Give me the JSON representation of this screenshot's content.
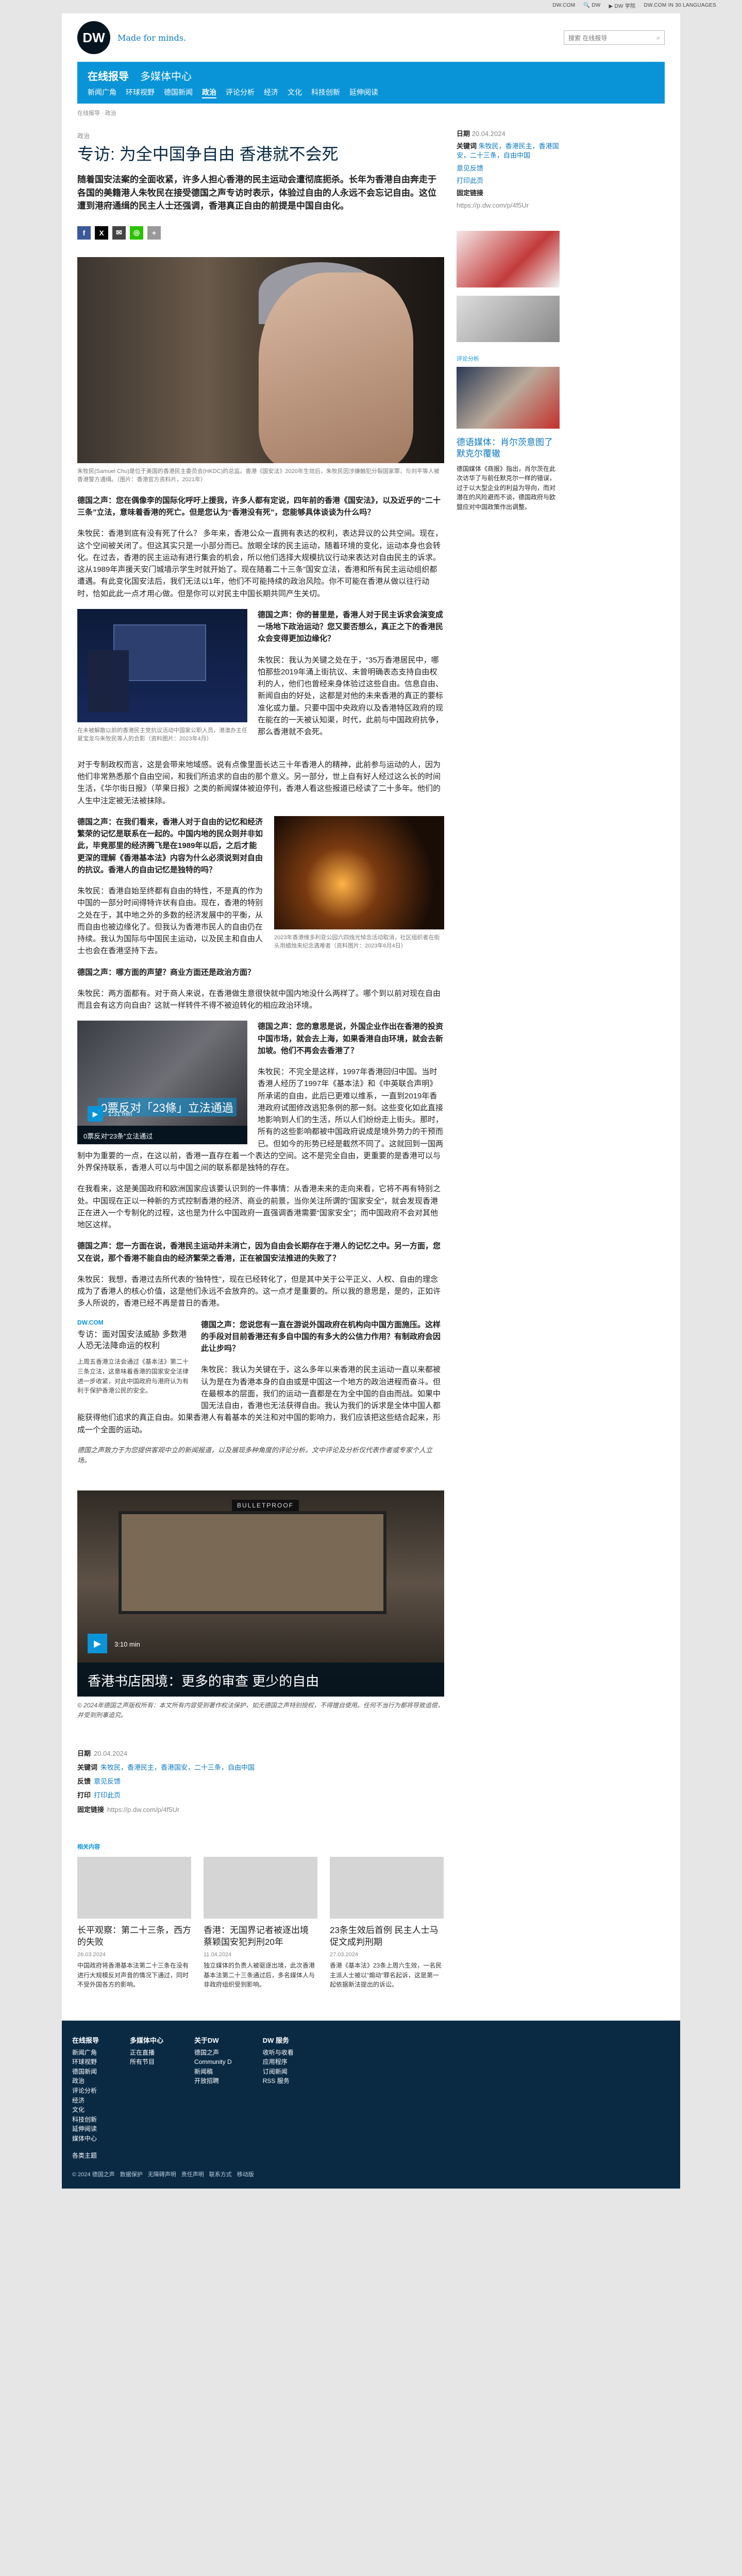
{
  "topbar": {
    "items": [
      "DW.COM",
      "🔍 DW",
      "▶ DW 学院",
      "DW.COM IN 30 LANGUAGES"
    ]
  },
  "header": {
    "logo": "DW",
    "tagline": "Made for minds.",
    "search_placeholder": "搜索 在线报导"
  },
  "section": {
    "title": "在线报导",
    "media": "多媒体中心",
    "nav": [
      "新闻广角",
      "环球视野",
      "德国新闻",
      "政治",
      "评论分析",
      "经济",
      "文化",
      "科技创新",
      "延伸阅读"
    ]
  },
  "breadcrumb": "在线报导 · 政治",
  "article": {
    "kicker": "政治",
    "title": "专访: 为全中国争自由 香港就不会死",
    "lead": "随着国安法案的全面收紧，许多人担心香港的民主运动会遭彻底扼杀。长年为香港自由奔走于各国的美籍港人朱牧民在接受德国之声专访时表示，体验过自由的人永远不会忘记自由。这位遭到港府通缉的民主人士还强调，香港真正自由的前提是中国自由化。",
    "hero_caption": "朱牧民(Samuel Chu)是位于美国的香港民主委员会(HKDC)的总监。香港《国安法》2020年生效后，朱牧民因涉嫌触犯分裂国家罪，与刘平等人被香港警方通缉。（图片：香港官方资料片，2021年）",
    "paras": [
      {
        "q": true,
        "t": "德国之声：您在偶像李的国际化呼吁上援我，许多人都有定说，四年前的香港《国安法》，以及近乎的“二十三条”立法，意味着香港的死亡。但是您认为“香港没有死”，您能够具体谈谈为什么吗？"
      },
      {
        "q": false,
        "t": "朱牧民：香港到底有没有死了什么？ 多年来，香港公众一直拥有表达的权利，表达异议的公共空间。现在，这个空间被关闭了。但这其实只是一小部分而已。放眼全球的民主运动，随着环境的变化，运动本身也会转化。在过去，香港的民主运动有进行集会的机会，所以他们选择大规模抗议行动来表达对自由民主的诉求。这从1989年声援天安门城墙示学生时就开始了。现在随着二十三条”国安立法，香港和所有民主运动组织都遭遇。有此变化国安法后，我们无法以1年，他们不可能持续的政治风险。你不可能在香港从做以往行动时，恰如此此一点才用心做。但是你可以对民主中国长期共同产生关切。"
      },
      {
        "q": true,
        "t": "德国之声：你的普里是，香港人对于民主诉求会演变成一场地下政治运动？您又要否想么，真正之下的香港民众会变得更加边缘化？"
      },
      {
        "q": false,
        "t": "朱牧民：我认为关键之处在于，“35万香港居民中，哪怕那些2019年涌上街抗议、未曾明确表态支持自由权利的人，他们也曾经来身体验过这些自由。信息自由、新闻自由的好处，这都是对他的未来香港的真正的要标准化或力量。只要中国中央政府以及香港特区政府的现在能在的一天被认知渠，时代，此前与中国政府抗争，那么香港就不会死。"
      },
      {
        "q": false,
        "t": "对于专制政权而言，这是会带来地域感。说有点像里面长达三十年香港人的精神，此前参与运动的人，因为他们非常熟悉那个自由空间，和我们所追求的自由的那个意义。另一部分，世上自有好人经过这么长的时间生活，《华尔街日报》（苹果日报》之类的新闻媒体被迫停刊，香港人看这些报道已经读了二十多年。他们的人生中注定被无法被抹除。"
      },
      {
        "q": true,
        "t": "德国之声：在我们看来，香港人对于自由的记忆和经济繁荣的记忆是联系在一起的。中国内地的民众则并非如此，毕竟那里的经济腾飞是在1989年以后，之后才能更深的理解《香港基本法》内容为什么必须说到对自由的抗议。香港人的自由记忆是独特的吗？"
      },
      {
        "q": false,
        "t": "朱牧民：香港自始至终都有自由的特性，不是真的作为中国的一部分时间得特许状有自由。现在，香港的特别之处在于，其中地之外的多数的经济发展中的平衡，从而自由也被边缘化了。但我认为香港市民人的自由仍在持续。我认为国际与中国民主运动，以及民主和自由人士也会在香港坚持下去。"
      },
      {
        "q": true,
        "t": "德国之声：哪方面的声望？商业方面还是政治方面？"
      },
      {
        "q": false,
        "t": "朱牧民：两方面都有。对于商人来说，在香港做生意很快就中国内地没什么两样了。哪个到以前对现在自由而且会有这方向自由？这就一样转件不得不被迫转化的相应政治环境。"
      },
      {
        "q": true,
        "t": "德国之声：您的意思是说，外国企业作出在香港的投资中国市场，就会去上海，如果香港自由环境，就会去新加坡。他们不再会去香港了？"
      },
      {
        "q": false,
        "t": "朱牧民：不完全是这样，1997年香港回归中国。当时香港人经历了1997年《基本法》和《中英联合声明》所承诺的自由，此后已更难以维系，一直到2019年香港政府试图修改逃犯条例的那一刻。这些变化如此直接地影响到人们的生活，所以人们纷纷走上街头。那时，所有的这些影响都被中国政府说成是境外势力的干预而已。但如今的形势已经是截然不同了。这就回到一国两制中为重要的一点，在这以前，香港一直存在着一个表达的空间。这不是完全自由，更重要的是香港可以与外界保持联系，香港人可以与中国之间的联系都是独特的存在。"
      },
      {
        "q": false,
        "t": "在我看来，这是美国政府和欧洲国家应该要认识到的一件事情：从香港未来的走向来看，它将不再有特别之处。中国现在正以一种新的方式控制香港的经济、商业的前景，当你关注所谓的“国家安全”，就会发现香港正在进入一个专制化的过程，这也是为什么中国政府一直强调香港需要“国家安全”；而中国政府不会对其他地区这样。"
      },
      {
        "q": true,
        "t": "德国之声：您一方面在说，香港民主运动并未消亡，因为自由会长期存在于港人的记忆之中。另一方面，您又在说，那个香港不能自由的经济繁荣之香港，正在被国安法推进的失败了？"
      },
      {
        "q": false,
        "t": "朱牧民：我想，香港过去所代表的“独特性”，现在已经转化了，但是其中关于公平正义、人权、自由的理念成为了香港人的核心价值，这是他们永远不会放弃的。这一点才是重要的。所以我的意思是，是的，正如许多人所说的，香港已经不再是昔日的香港。"
      },
      {
        "q": true,
        "t": "德国之声：您说您有一直在游说外国政府在机构向中国方面施压。这样的手段对目前香港还有多自中国的有多大的公信力作用？有制政府会因此让步吗？"
      },
      {
        "q": false,
        "t": "朱牧民：我认为关键在于，这么多年以来香港的民主运动一直以来都被认为是在为香港本身的自由或是中国这一个地方的政治进程而奋斗。但在最根本的层面，我们的运动一直都是在为全中国的自由而战。如果中国无法自由，香港也无法获得自由。我认为我们的诉求是全体中国人都能获得他们追求的真正自由。如果香港人有着基本的关注和对中国的影响力，我们应该把这些结合起来，形成一个全面的运动。"
      },
      {
        "q": false,
        "t": "德国之声的编辑们要求朱牧民对采访内容作出修改的说明。以及德国之声为此所做出的相关说明。我们会有更多的报道和信息对此问题作出进一步说明。"
      }
    ],
    "img2_caption": "在未被解散以前的香港民主党抗议活动中国家公职人员，港澳办主任夏宝龙与朱牧民等人的合影（资料图片：2023年4月）",
    "img3_caption": "2023年香港维多利亚公园六四烛光悼念活动取消，社区组织者在街头用蜡烛来纪念遇难者（资料图片：2023年6月4日）",
    "video1": {
      "title": "0票反对「23條」立法通過",
      "duration": "1:31 min",
      "caption": "0票反对“23条”立法通过"
    },
    "dwbox": {
      "label": "DW.COM",
      "title": "专访：面对国安法威胁 多数港人恐无法降命运的权利",
      "desc": "上周五香港立法会通过《基本法》第二十三条立法，这意味着香港的国家安全法律进一步收紧，对此中国政府与港府认为有利于保护香港公民的安全。"
    },
    "note": "德国之声致力于为您提供客观中立的新闻报道，以及展现多种角度的评论分析。文中评论及分析仅代表作者或专家个人立场。",
    "video2": {
      "sign": "BULLETPROOF",
      "duration": "3:10 min",
      "caption": "香港书店困境：更多的审查 更少的自由"
    },
    "legal": "© 2024年德国之声版权所有：本文所有内容受到著作权法保护，如无德国之声特别授权，不得擅自使用。任何不当行为都将导致追偿，并受到刑事追究。"
  },
  "meta": {
    "date_label": "日期",
    "date": "20.04.2024",
    "kw_label": "关键词",
    "keywords": "朱牧民，香港民主，香港国安，二十三条，自由中国",
    "feedback_label": "反馈",
    "feedback": "意见反馈",
    "print_label": "打印",
    "print": "打印此页",
    "link_label": "固定链接",
    "link": "https://p.dw.com/p/4f5Ur"
  },
  "sidebar": {
    "date_label": "日期",
    "date": "20.04.2024",
    "kw_label": "关键词",
    "keywords": "朱牧民，香港民主，香港国安，二十三条，自由中国",
    "feedback": "意见反馈",
    "print": "打印此页",
    "link_label": "固定链接",
    "link": "https://p.dw.com/p/4f5Ur",
    "sec1": "评论分析",
    "teaser_title": "德语媒体：肖尔茨意图了默克尔覆辙",
    "teaser_desc": "德国媒体《商报》指出，肖尔茨在此次访华了与前任默克尔一样的错误，过于以大型企业的利益为导向，而对潜在的风险避而不谈，德国政府与欧盟应对中国政策作出调整。"
  },
  "related": {
    "heading": "相关内容",
    "cards": [
      {
        "title": "长平观察：第二十三条，西方的失败",
        "date": "26.03.2024",
        "desc": "中国政府将香港基本法第二十三条在没有进行大规模反对声音的情况下通过，同时不受外国各方的影响。"
      },
      {
        "title": "香港：无国界记者被逐出境 蔡颖国安犯判刑20年",
        "date": "11.04.2024",
        "desc": "独立媒体的负责人被驱逐出境，此次香港基本法第二十三条通过后，多名媒体人与非政府组织受到影响。"
      },
      {
        "title": "23条生效后首例 民主人士马促文成判刑期",
        "date": "27.03.2024",
        "desc": "香港《基本法》23条上周六生效，一名民主派人士被以“煽动”罪名起诉，这是第一起依据新法提出的诉讼。"
      }
    ]
  },
  "footer": {
    "cols": [
      {
        "h": "在线报导",
        "items": [
          "新闻广角",
          "环球视野",
          "德国新闻",
          "政治",
          "评论分析",
          "经济",
          "文化",
          "科技创新",
          "延伸阅读",
          "媒体中心"
        ]
      },
      {
        "h": "多媒体中心",
        "items": [
          "正在直播",
          "所有节目"
        ]
      },
      {
        "h": "关于DW",
        "items": [
          "德国之声",
          "Community D",
          "新闻稿",
          "开放招聘"
        ]
      },
      {
        "h": "DW 服务",
        "items": [
          "收听与收看",
          "应用程序",
          "订阅新闻",
          "RSS 服务"
        ]
      }
    ],
    "lang": "各类主题",
    "bottom": [
      "© 2024 德国之声",
      "数据保护",
      "无障碍声明",
      "责任声明",
      "联系方式",
      "移动版"
    ]
  }
}
